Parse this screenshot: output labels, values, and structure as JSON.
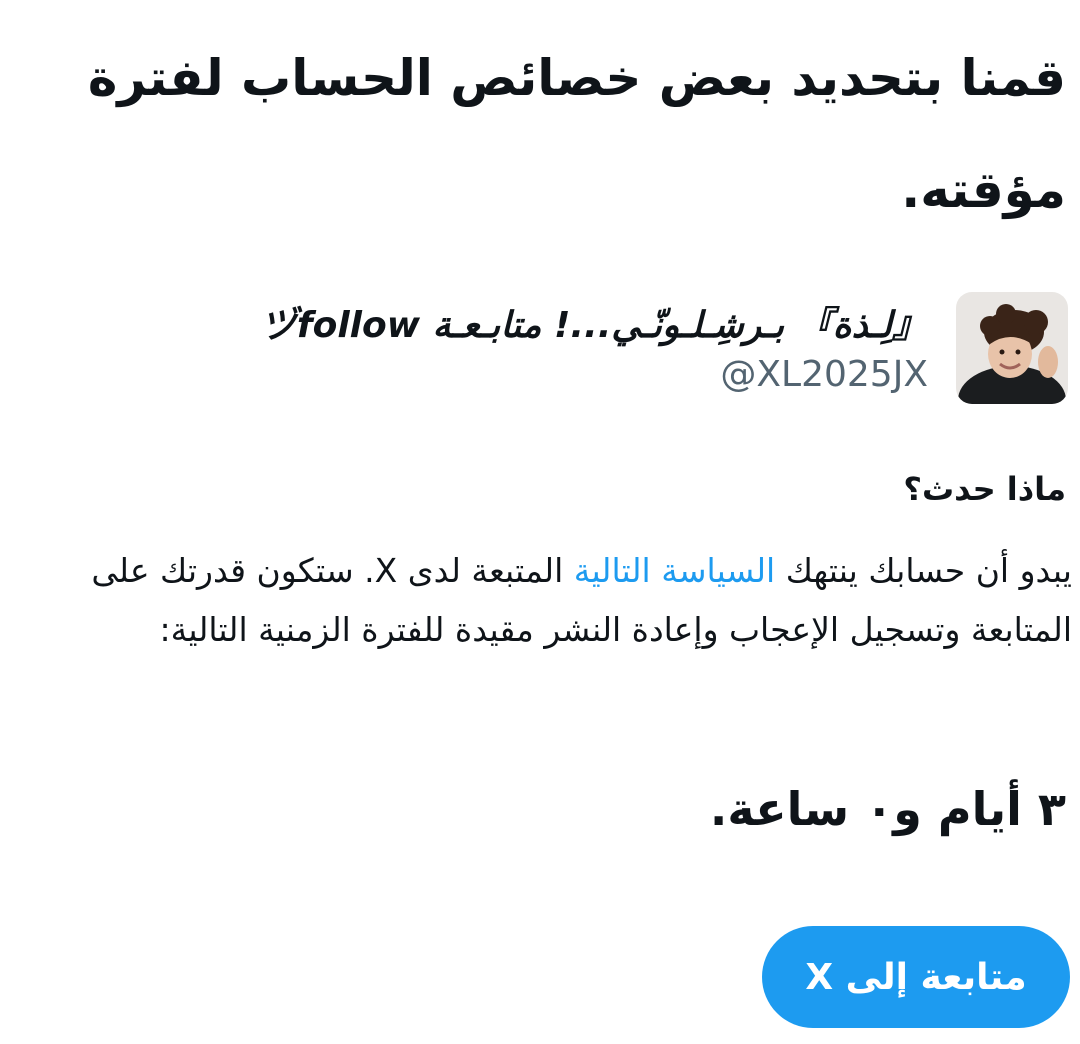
{
  "notice": {
    "title": "قمنا بتحديد بعض خصائص الحساب لفترة مؤقته."
  },
  "account": {
    "display_name": "『لِـذة』 بـرشِـلـونّـي...! متابـعـة ヅfollow",
    "handle": "@XL2025JX"
  },
  "details": {
    "heading": "ماذا حدث؟",
    "text_before_link": "يبدو أن حسابك ينتهك ",
    "policy_link": "السياسة التالية",
    "text_after_link": " المتبعة لدى X. ستكون قدرتك على المتابعة وتسجيل الإعجاب وإعادة النشر مقيدة للفترة الزمنية التالية:",
    "duration": "٣ أيام و٠ ساعة."
  },
  "actions": {
    "continue_label": "متابعة إلى X"
  },
  "colors": {
    "accent": "#1d9bf0",
    "text": "#0f1419",
    "secondary_text": "#536471"
  }
}
